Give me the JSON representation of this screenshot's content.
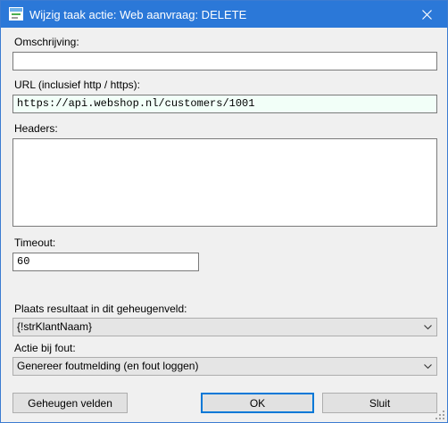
{
  "window": {
    "title": "Wijzig taak actie: Web aanvraag: DELETE",
    "icon": "task-window-icon",
    "close_icon": "close-icon"
  },
  "form": {
    "description_label": "Omschrijving:",
    "description_value": "",
    "url_label": "URL (inclusief http / https):",
    "url_value": "https://api.webshop.nl/customers/1001",
    "headers_label": "Headers:",
    "headers_value": "",
    "timeout_label": "Timeout:",
    "timeout_value": "60",
    "result_label": "Plaats resultaat in dit geheugenveld:",
    "result_value": "{!strKlantNaam}",
    "error_label": "Actie bij fout:",
    "error_value": "Genereer foutmelding (en fout loggen)"
  },
  "buttons": {
    "memory_fields": "Geheugen velden",
    "ok": "OK",
    "close": "Sluit"
  },
  "colors": {
    "titlebar": "#2b78d8",
    "url_background": "#f2fff8",
    "default_button_border": "#0078d7"
  }
}
